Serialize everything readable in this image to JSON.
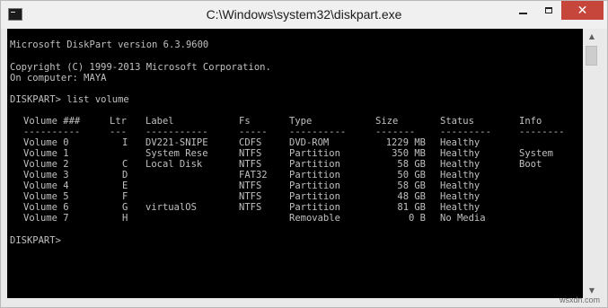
{
  "window": {
    "title": "C:\\Windows\\system32\\diskpart.exe",
    "controls": {
      "minimize": "",
      "maximize": "",
      "close": "✕"
    }
  },
  "console": {
    "header_line": "Microsoft DiskPart version 6.3.9600",
    "copyright_line": "Copyright (C) 1999-2013 Microsoft Corporation.",
    "computer_line": "On computer: MAYA",
    "command_line": "DISKPART> list volume",
    "prompt_line": "DISKPART> ",
    "columns": {
      "volume": "Volume ###",
      "ltr": "Ltr",
      "label": "Label",
      "fs": "Fs",
      "type": "Type",
      "size": "Size",
      "status": "Status",
      "info": "Info"
    },
    "separators": {
      "volume": "----------",
      "ltr": "---",
      "label": "-----------",
      "fs": "-----",
      "type": "----------",
      "size": "-------",
      "status": "---------",
      "info": "--------"
    },
    "rows": [
      {
        "volume": "Volume 0",
        "ltr": "I",
        "label": "DV221-SNIPE",
        "fs": "CDFS",
        "type": "DVD-ROM",
        "size": "1229 MB",
        "status": "Healthy",
        "info": ""
      },
      {
        "volume": "Volume 1",
        "ltr": "",
        "label": "System Rese",
        "fs": "NTFS",
        "type": "Partition",
        "size": "350 MB",
        "status": "Healthy",
        "info": "System"
      },
      {
        "volume": "Volume 2",
        "ltr": "C",
        "label": "Local Disk",
        "fs": "NTFS",
        "type": "Partition",
        "size": "58 GB",
        "status": "Healthy",
        "info": "Boot"
      },
      {
        "volume": "Volume 3",
        "ltr": "D",
        "label": "",
        "fs": "FAT32",
        "type": "Partition",
        "size": "50 GB",
        "status": "Healthy",
        "info": ""
      },
      {
        "volume": "Volume 4",
        "ltr": "E",
        "label": "",
        "fs": "NTFS",
        "type": "Partition",
        "size": "58 GB",
        "status": "Healthy",
        "info": ""
      },
      {
        "volume": "Volume 5",
        "ltr": "F",
        "label": "",
        "fs": "NTFS",
        "type": "Partition",
        "size": "48 GB",
        "status": "Healthy",
        "info": ""
      },
      {
        "volume": "Volume 6",
        "ltr": "G",
        "label": "virtualOS",
        "fs": "NTFS",
        "type": "Partition",
        "size": "81 GB",
        "status": "Healthy",
        "info": ""
      },
      {
        "volume": "Volume 7",
        "ltr": "H",
        "label": "",
        "fs": "",
        "type": "Removable",
        "size": "0 B",
        "status": "No Media",
        "info": ""
      }
    ]
  },
  "watermark": "wsxdn.com"
}
